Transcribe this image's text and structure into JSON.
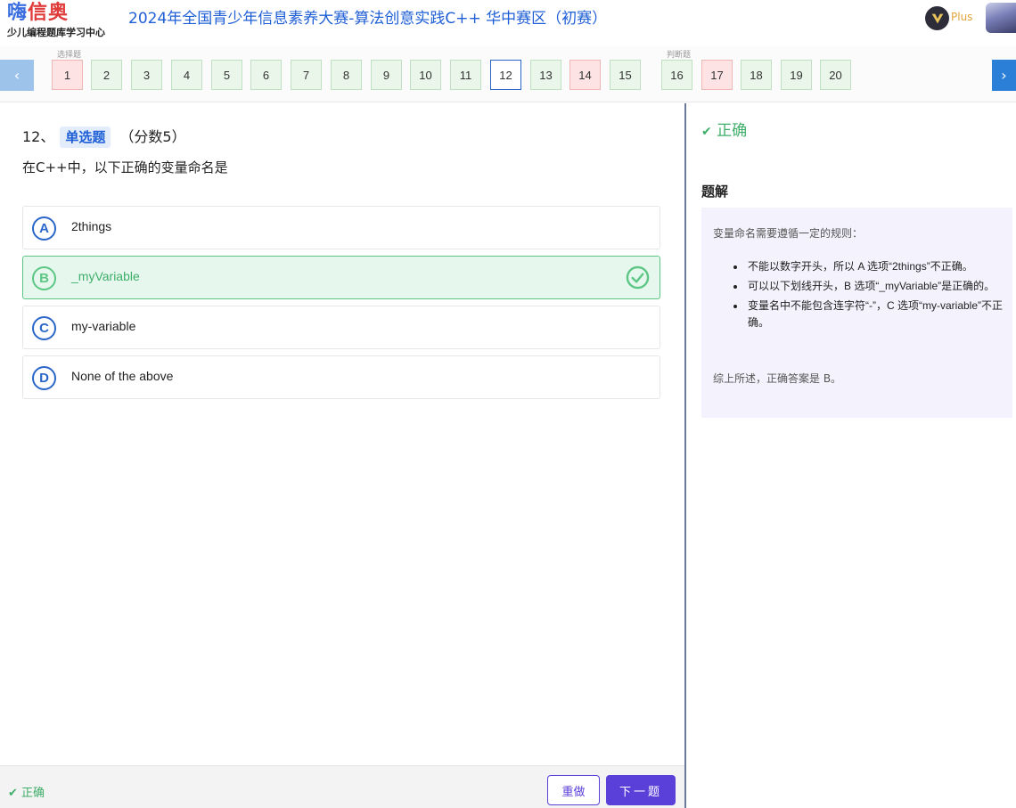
{
  "header": {
    "logo_main_a": "嗨",
    "logo_main_b": "信奥",
    "logo_sub": "少儿编程题库学习中心",
    "title": "2024年全国青少年信息素养大赛-算法创意实践C++ 华中赛区（初赛）",
    "plus_label": "Plus"
  },
  "nav": {
    "group_single": "选择题",
    "group_judge": "判断题",
    "questions": [
      {
        "num": "1",
        "status": "wrong"
      },
      {
        "num": "2",
        "status": "correct"
      },
      {
        "num": "3",
        "status": "correct"
      },
      {
        "num": "4",
        "status": "correct"
      },
      {
        "num": "5",
        "status": "correct"
      },
      {
        "num": "6",
        "status": "correct"
      },
      {
        "num": "7",
        "status": "correct"
      },
      {
        "num": "8",
        "status": "correct"
      },
      {
        "num": "9",
        "status": "correct"
      },
      {
        "num": "10",
        "status": "correct"
      },
      {
        "num": "11",
        "status": "correct"
      },
      {
        "num": "12",
        "status": "current"
      },
      {
        "num": "13",
        "status": "correct"
      },
      {
        "num": "14",
        "status": "wrong"
      },
      {
        "num": "15",
        "status": "correct"
      },
      {
        "num": "16",
        "status": "correct"
      },
      {
        "num": "17",
        "status": "wrong"
      },
      {
        "num": "18",
        "status": "correct"
      },
      {
        "num": "19",
        "status": "correct"
      },
      {
        "num": "20",
        "status": "correct"
      }
    ]
  },
  "question": {
    "number": "12、",
    "type": "单选题",
    "score": "（分数5）",
    "text": "在C++中，以下正确的变量命名是",
    "options": [
      {
        "letter": "A",
        "text": "2things",
        "correct": false
      },
      {
        "letter": "B",
        "text": "_myVariable",
        "correct": true
      },
      {
        "letter": "C",
        "text": "my-variable",
        "correct": false
      },
      {
        "letter": "D",
        "text": "None of the above",
        "correct": false
      }
    ]
  },
  "footer": {
    "status": "正确",
    "redo_label": "重做",
    "next_label": "下一题"
  },
  "result": {
    "status": "正确"
  },
  "explanation": {
    "title": "题解",
    "intro": "变量命名需要遵循一定的规则：",
    "points": [
      "不能以数字开头，所以 A 选项“2things”不正确。",
      "可以以下划线开头，B 选项“_myVariable”是正确的。",
      "变量名中不能包含连字符“-”，C 选项“my-variable”不正确。"
    ],
    "conclusion": "综上所述，正确答案是 B。"
  },
  "colors": {
    "accent": "#5b3fd9",
    "title_blue": "#1f5fd6",
    "correct_green": "#3fae6a",
    "wrong_red": "#fde3e3"
  }
}
